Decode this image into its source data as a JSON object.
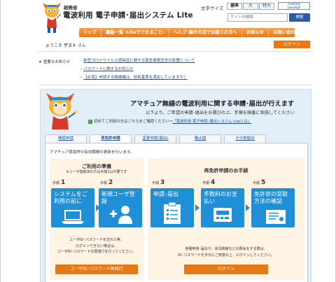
{
  "header": {
    "org": "総務省",
    "title": "電波利用 電子申請･届出システム Lite",
    "font_size_label": "文字サイズ",
    "font_sizes": [
      "標準",
      "大",
      "特大"
    ],
    "contrast_label": "Contrast\nLow,High",
    "search_placeholder": "サイト内検索",
    "search_button": "検索"
  },
  "nav": {
    "items": [
      "トップ",
      "機能一覧 ‐Liteでできること‐",
      "ヘルプ･操作方法でお困りの方へ",
      "お知らせ",
      "お問い合わせ"
    ]
  },
  "user": {
    "prefix": "ようこそ",
    "name": "ゲスト",
    "suffix": "さん",
    "login_button": "ログイン"
  },
  "notices": {
    "label": "重要なお知らせ",
    "items": [
      "新型コロナウイルス感染症に関する緊急事態宣言の影響について",
      "パスワードに関するお知らせ",
      "【必見】申請する無線機は、技術基準を満足していますか？"
    ]
  },
  "main": {
    "title": "アマチュア無線の電波利用に関する申請･届出が行えます",
    "subtitle": "以下より、ご希望の申請･届出をお選びの上、手順を順番に実施してください",
    "first_time_prefix": "初めてご利用の方はこちらをご確認ください⇒",
    "first_time_link": "「電波利用 電子申請･届出システム Liteとは」",
    "tabs": [
      "開局申請",
      "再免許申請",
      "変更申請(届出)",
      "廃止届",
      "その他届出"
    ],
    "active_tab": 1,
    "lead": "アマチュア局免許の有効期間の更新を行います。",
    "prep": {
      "title": "ご利用の準備",
      "note": "※ユーザ登録済の方は手順1は不要です",
      "help1": "ユーザID･パスワードを忘れた等、",
      "help2": "ログインできない場合は、",
      "help3": "ユーザID･パスワードの再発行を行ってください。",
      "button": "ユーザID･パスワード再発行"
    },
    "process": {
      "title": "再免許申請のお手続",
      "help1": "各種申請･届出や、状況検索などの照会をする際は、",
      "help2": "ID･パスワードを手元にご用意の上、ログインしてください。",
      "button": "ログイン"
    },
    "steps": [
      {
        "label": "手順",
        "num": "1",
        "text": "システムをご利用の前に",
        "icon": "laptop-icon"
      },
      {
        "label": "手順",
        "num": "2",
        "text": "新規ユーザ登録",
        "icon": "add-user-icon"
      },
      {
        "label": "手順",
        "num": "3",
        "text": "申請･届出",
        "icon": "clipboard-icon"
      },
      {
        "label": "手順",
        "num": "4",
        "text": "手数料のお支払い",
        "icon": "payment-icon"
      },
      {
        "label": "手順",
        "num": "5",
        "text": "免許状の受取方法の確認",
        "icon": "certificate-icon"
      }
    ]
  },
  "colors": {
    "accent_orange": "#e67816",
    "step_blue": "#1f8fd8",
    "panel_blue": "#e2eff8",
    "box_cream": "#fff3e4",
    "link_blue": "#1c4f9c"
  }
}
